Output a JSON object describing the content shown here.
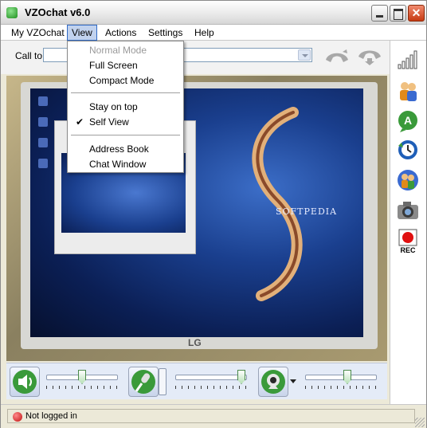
{
  "window": {
    "title": "VZOchat v6.0"
  },
  "menubar": {
    "items": [
      {
        "label": "My VZOchat"
      },
      {
        "label": "View"
      },
      {
        "label": "Actions"
      },
      {
        "label": "Settings"
      },
      {
        "label": "Help"
      }
    ]
  },
  "view_menu": {
    "items": [
      {
        "label": "Normal Mode",
        "enabled": false,
        "checked": false
      },
      {
        "label": "Full Screen",
        "enabled": true,
        "checked": false
      },
      {
        "label": "Compact Mode",
        "enabled": true,
        "checked": false
      },
      {
        "label": "Stay on top",
        "enabled": true,
        "checked": false
      },
      {
        "label": "Self View",
        "enabled": true,
        "checked": true
      },
      {
        "label": "Address Book",
        "enabled": true,
        "checked": false
      },
      {
        "label": "Chat Window",
        "enabled": true,
        "checked": false
      }
    ]
  },
  "call": {
    "label": "Call to:",
    "value": ""
  },
  "video": {
    "watermark": "SOFTPEDIA",
    "monitor_brand": "LG"
  },
  "controls": {
    "speaker_volume": 0.5,
    "mic_volume": 0.97,
    "camera_level": 0.6
  },
  "right_toolbar": {
    "icons": [
      "signal-strength-icon",
      "contacts-icon",
      "chat-icon",
      "history-icon",
      "conference-icon",
      "snapshot-camera-icon",
      "record-icon"
    ],
    "rec_label": "REC"
  },
  "status": {
    "text": "Not logged in"
  },
  "colors": {
    "status_offline": "#c01010",
    "menu_highlight": "#c1d2ee",
    "accent_green": "#2e9e2e"
  }
}
